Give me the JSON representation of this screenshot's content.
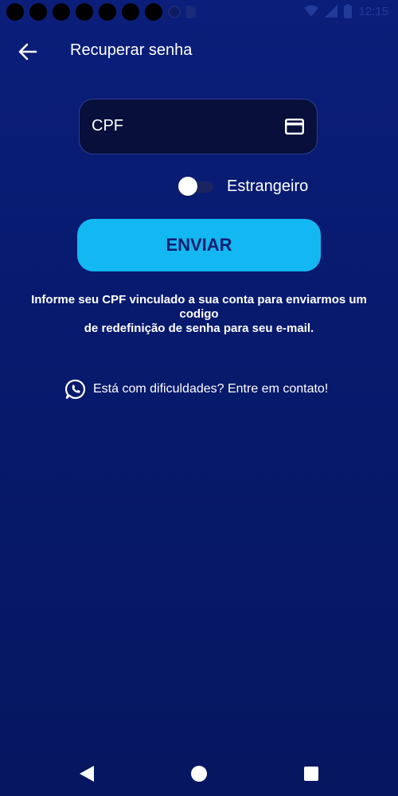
{
  "status_bar": {
    "time": "12:15"
  },
  "header": {
    "title": "Recuperar senha"
  },
  "form": {
    "cpf_label": "CPF",
    "foreigner_toggle_label": "Estrangeiro",
    "foreigner_toggle_on": false,
    "send_button_label": "ENVIAR"
  },
  "info_text": {
    "line1": "Informe seu CPF vinculado a sua conta para enviarmos um",
    "line2": "codigo",
    "line3": "de redefinição de senha para seu e-mail."
  },
  "contact": {
    "label": "Está com dificuldades? Entre em contato!"
  },
  "colors": {
    "background": "#0b1e7a",
    "button": "#13b8f2",
    "button_text": "#0e1e6e",
    "field_bg": "#070f3a"
  },
  "icons": [
    "back-arrow-icon",
    "credit-card-icon",
    "whatsapp-icon",
    "nav-back-icon",
    "nav-home-icon",
    "nav-recent-icon"
  ]
}
